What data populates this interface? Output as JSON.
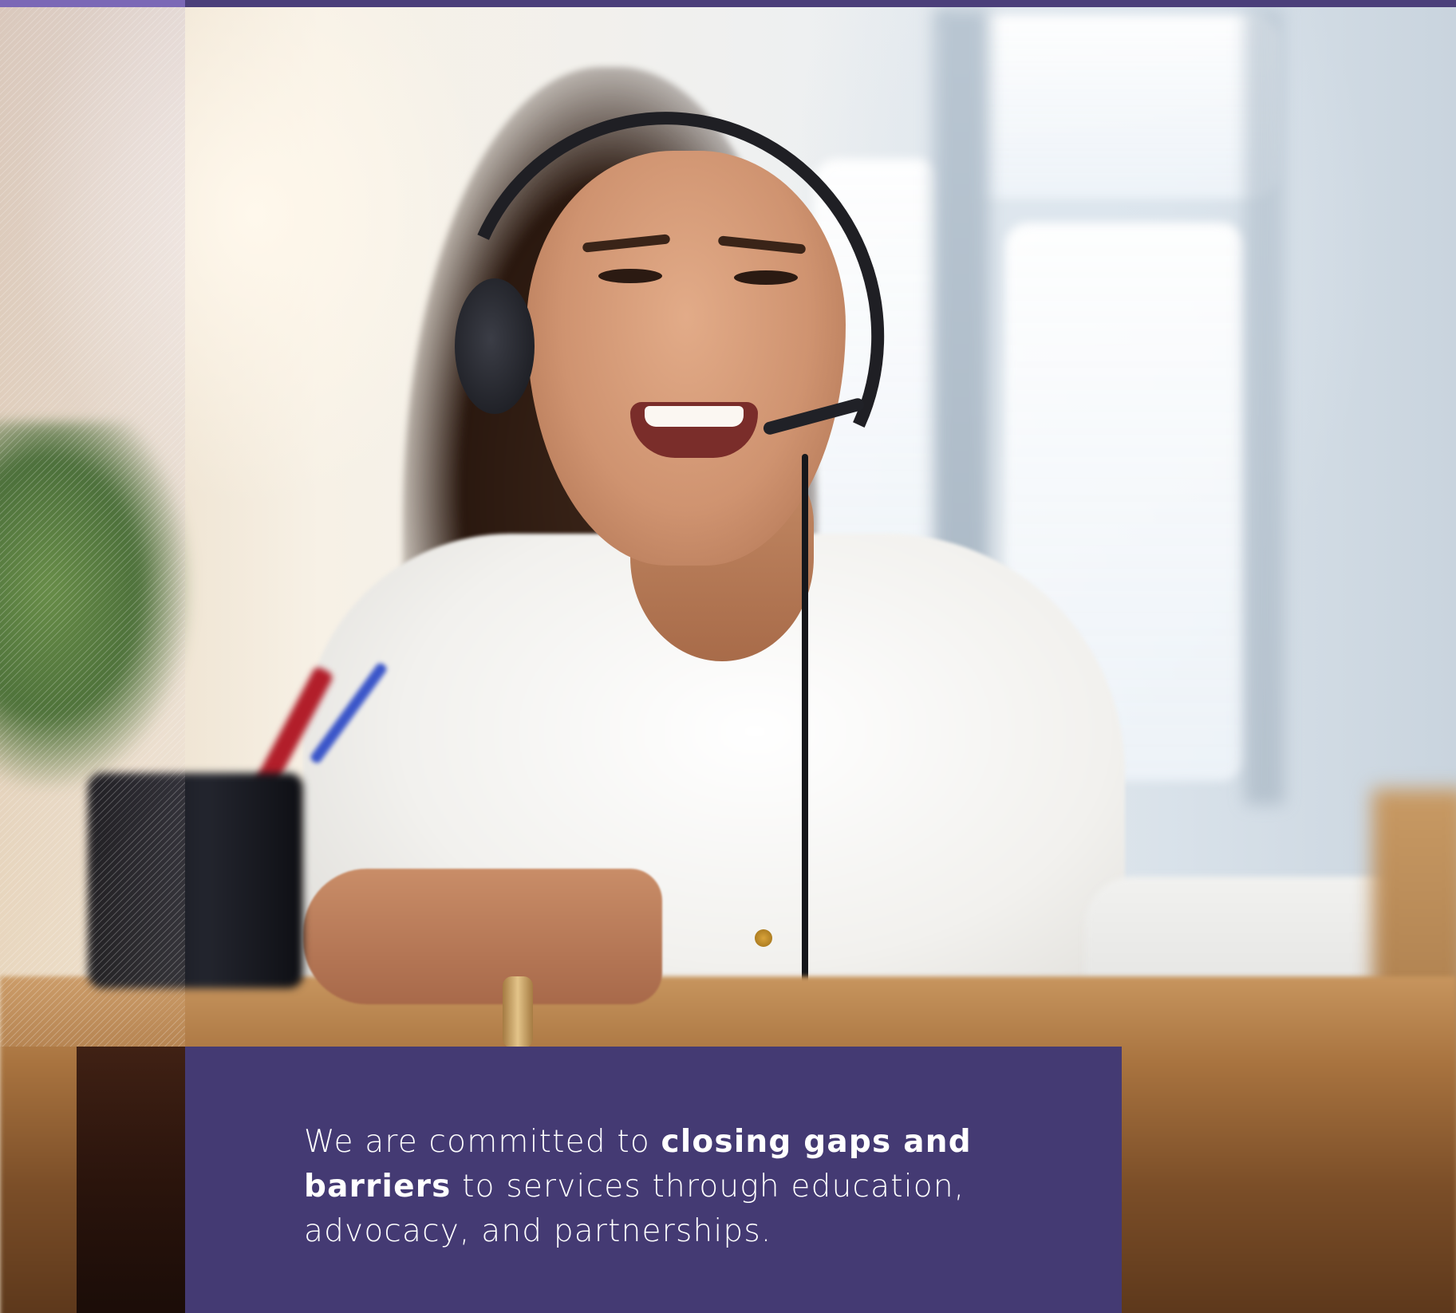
{
  "colors": {
    "top_bar": "#4b3f7a",
    "top_bar_accent": "#7b68b6",
    "panel_background": "#443a73",
    "panel_text": "#ffffff"
  },
  "photo": {
    "subject": "photo-customer-service-agent-headset"
  },
  "panel": {
    "text_lead": "We are committed to ",
    "text_bold": "closing gaps and barriers",
    "text_tail": " to services through education, advocacy, and partnerships."
  }
}
